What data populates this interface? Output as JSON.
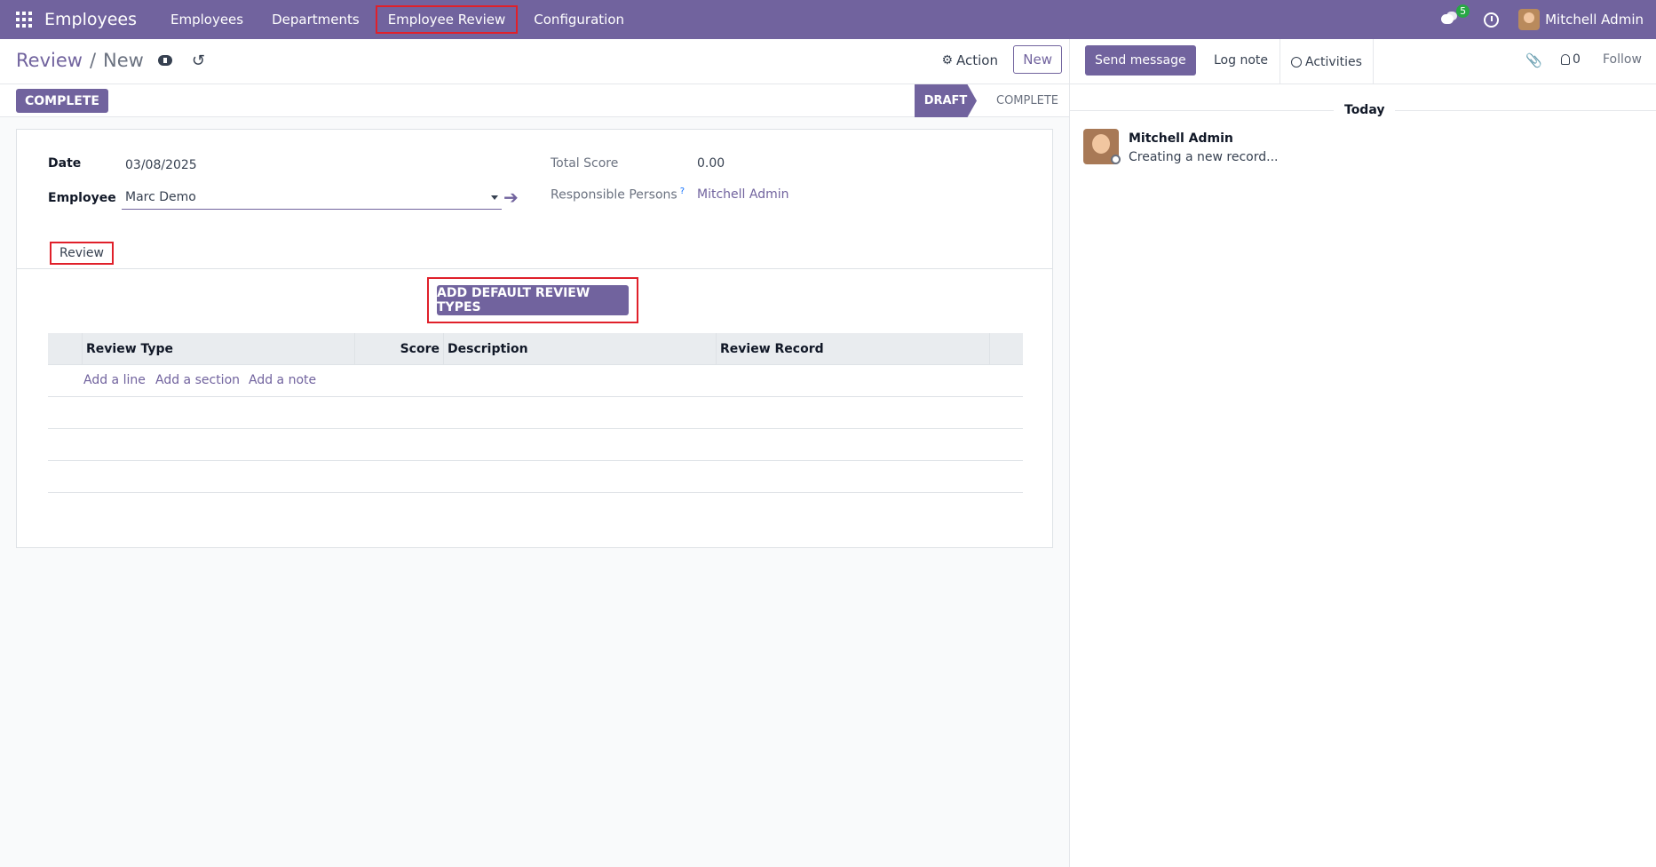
{
  "navbar": {
    "brand": "Employees",
    "items": [
      "Employees",
      "Departments",
      "Employee Review",
      "Configuration"
    ],
    "chat_badge": "5",
    "user_name": "Mitchell Admin"
  },
  "control_panel": {
    "breadcrumb_parent": "Review",
    "breadcrumb_sep": "/",
    "breadcrumb_current": "New",
    "action_label": "Action",
    "new_label": "New"
  },
  "statusbar": {
    "complete_button": "COMPLETE",
    "stages": [
      "DRAFT",
      "COMPLETE"
    ],
    "active_stage": "DRAFT"
  },
  "form": {
    "date_label": "Date",
    "date_value": "03/08/2025",
    "employee_label": "Employee",
    "employee_value": "Marc Demo",
    "total_score_label": "Total Score",
    "total_score_value": "0.00",
    "responsible_label": "Responsible Persons",
    "responsible_help": "?",
    "responsible_value": "Mitchell Admin",
    "tab_label": "Review",
    "add_default_label": "ADD DEFAULT REVIEW TYPES"
  },
  "table": {
    "columns": [
      "Review Type",
      "Score",
      "Description",
      "Review Record"
    ],
    "add_links": [
      "Add a line",
      "Add a section",
      "Add a note"
    ]
  },
  "chatter": {
    "send_message": "Send message",
    "log_note": "Log note",
    "activities": "Activities",
    "followers_count": "0",
    "follow": "Follow",
    "date_separator": "Today",
    "message_author": "Mitchell Admin",
    "message_body": "Creating a new record..."
  },
  "colors": {
    "brand": "#71639e",
    "highlight": "#e0202a",
    "badge": "#28a745"
  }
}
